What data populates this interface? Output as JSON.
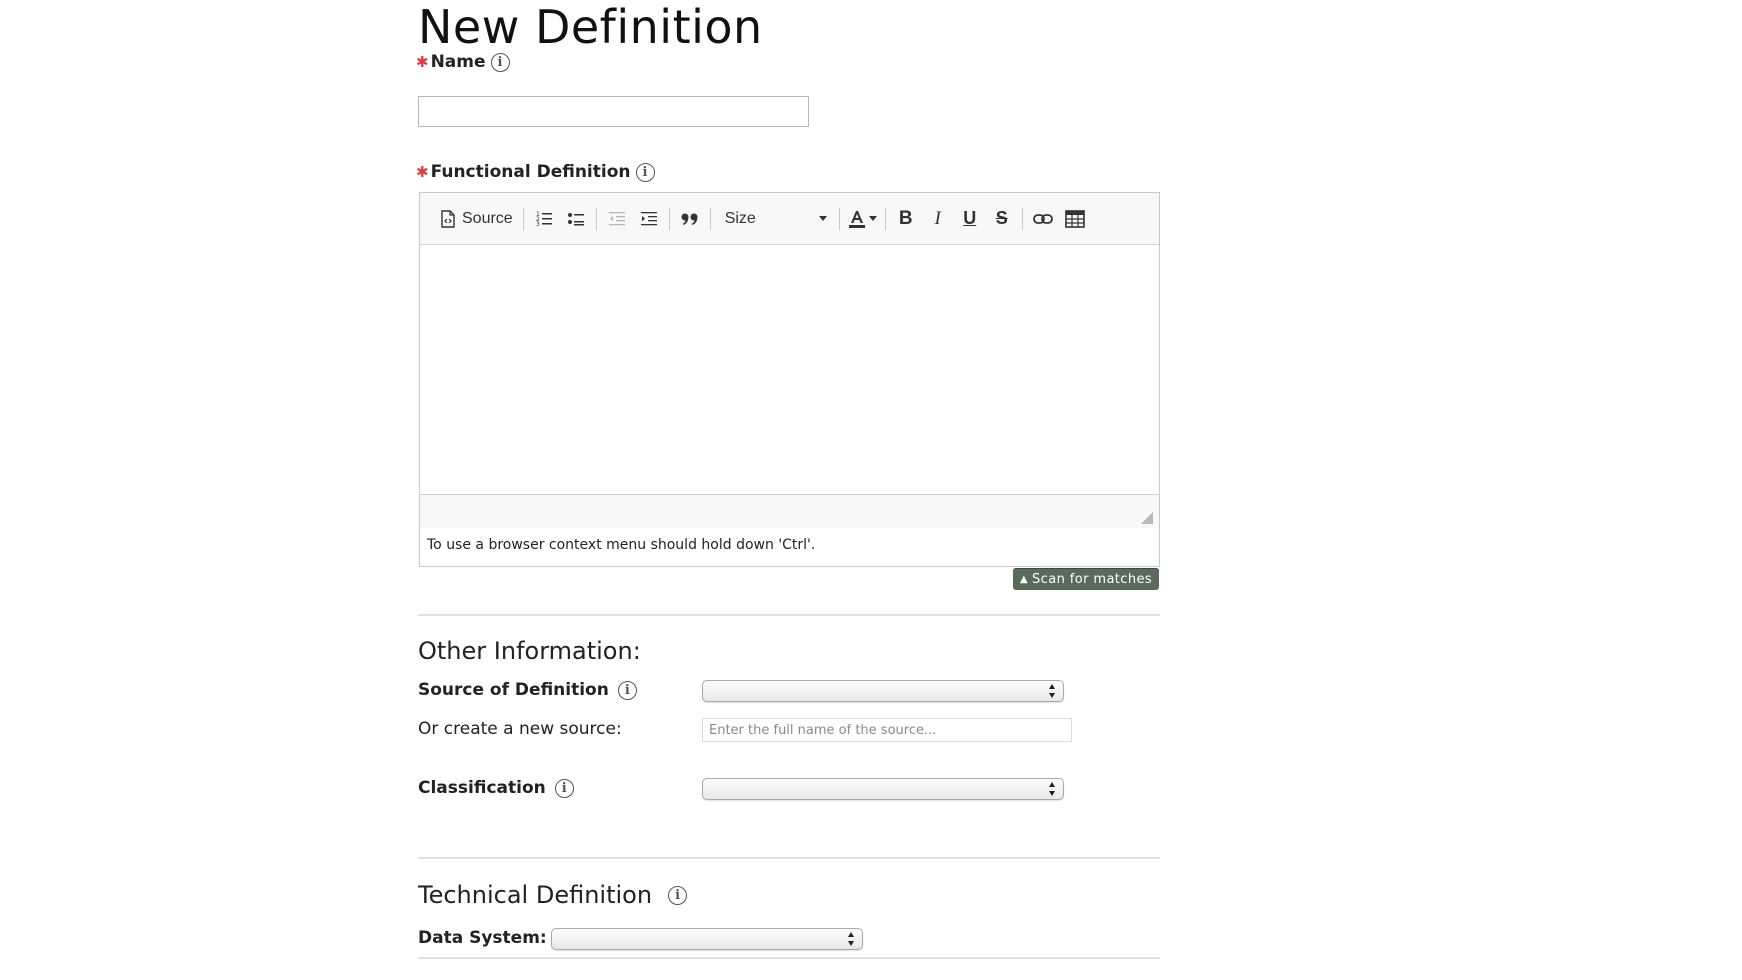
{
  "page_title": "New Definition",
  "name_field": {
    "label": "Name",
    "value": "",
    "placeholder": ""
  },
  "functional_definition": {
    "label": "Functional Definition",
    "toolbar": {
      "source_label": "Source",
      "size_label": "Size",
      "items": [
        "source",
        "numbered-list",
        "bulleted-list",
        "outdent",
        "indent",
        "blockquote",
        "size",
        "text-color",
        "bold",
        "italic",
        "underline",
        "strikethrough",
        "link",
        "table"
      ]
    },
    "content": "",
    "hint": "To use a browser context menu should hold down 'Ctrl'."
  },
  "scan_button": {
    "icon": "triangle-up-icon",
    "label": "Scan for matches"
  },
  "other_information": {
    "title": "Other Information:",
    "source_of_definition": {
      "label": "Source of Definition",
      "selected": ""
    },
    "new_source": {
      "label": "Or create a new source:",
      "value": "",
      "placeholder": "Enter the full name of the source..."
    },
    "classification": {
      "label": "Classification",
      "selected": ""
    }
  },
  "technical_definition": {
    "title": "Technical Definition",
    "data_system": {
      "label": "Data System:",
      "selected": ""
    }
  },
  "colors": {
    "required_marker": "#e0393e",
    "scan_button_bg": "#5b6b59",
    "divider": "#e1e1e1"
  }
}
